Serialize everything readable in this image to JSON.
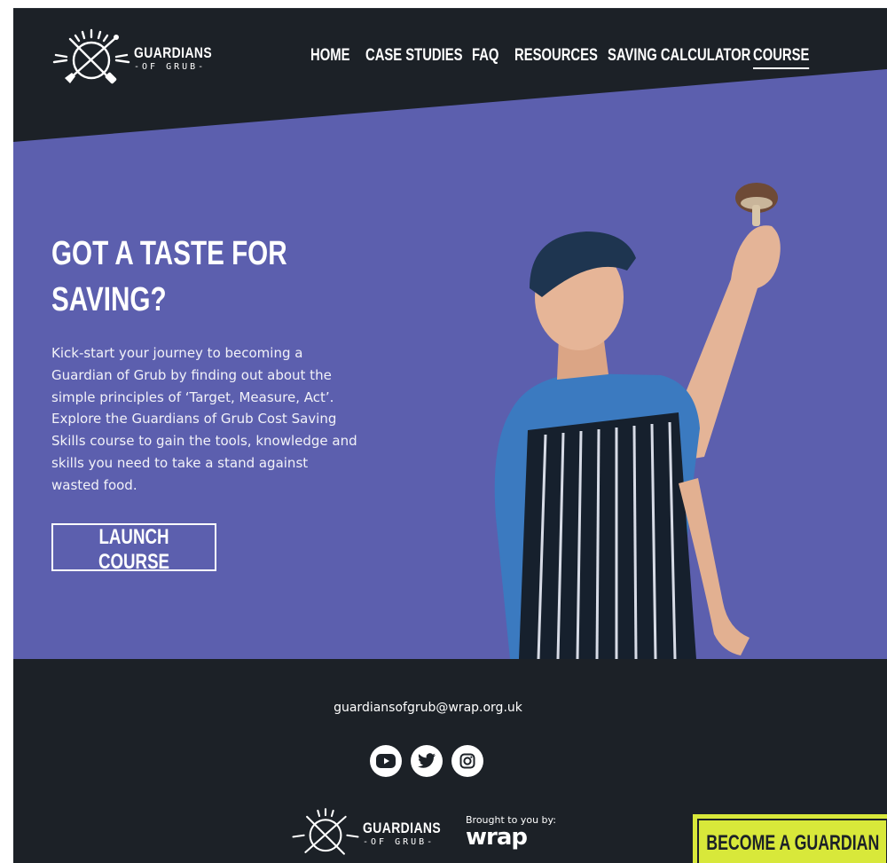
{
  "header": {
    "logo": {
      "title": "GUARDIANS",
      "subtitle": "-OF GRUB-"
    },
    "nav": [
      {
        "label": "HOME",
        "active": false
      },
      {
        "label": "CASE STUDIES",
        "active": false
      },
      {
        "label": "FAQ",
        "active": false
      },
      {
        "label": "RESOURCES",
        "active": false
      },
      {
        "label": "SAVING CALCULATOR",
        "active": false
      },
      {
        "label": "COURSE",
        "active": true
      }
    ]
  },
  "hero": {
    "title_line1": "GOT A TASTE FOR",
    "title_line2": "SAVING?",
    "body": "Kick-start your journey to becoming a Guardian of Grub by finding out about the simple principles of ‘Target, Measure, Act’. Explore the Guardians of Grub Cost Saving Skills course to gain the tools, knowledge and skills you need to take a stand against wasted food.",
    "button_label": "LAUNCH COURSE",
    "image": "chef-holding-mushroom"
  },
  "footer": {
    "email": "guardiansofgrub@wrap.org.uk",
    "socials": [
      "youtube-icon",
      "twitter-icon",
      "instagram-icon"
    ],
    "logo": {
      "title": "GUARDIANS",
      "subtitle": "-OF GRUB-"
    },
    "brought_by_label": "Brought to you by:",
    "partner": "wrap",
    "cta_label": "BECOME A GUARDIAN"
  },
  "colors": {
    "dark": "#1c2127",
    "hero": "#5c5fae",
    "accent": "#d8e83a",
    "white": "#ffffff"
  }
}
